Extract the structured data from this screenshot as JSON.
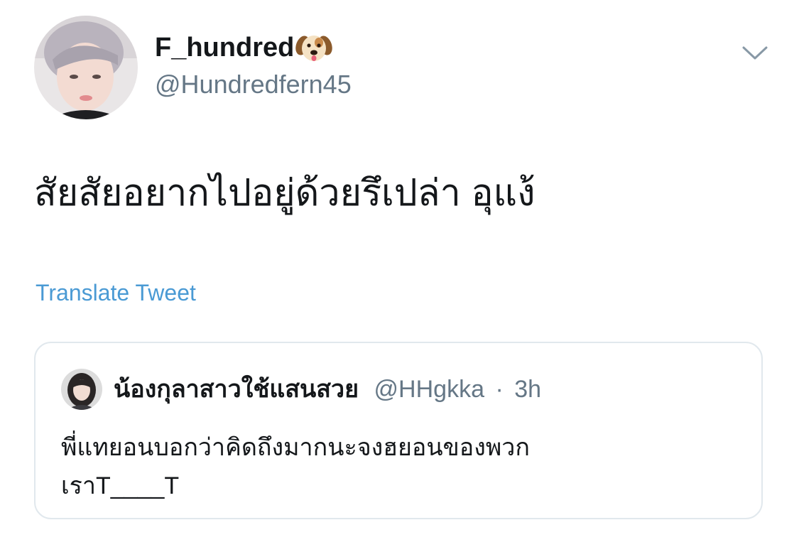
{
  "tweet": {
    "display_name": "F_hundred",
    "name_emoji": "dog-face-emoji",
    "handle": "@Hundredfern45",
    "menu_icon": "chevron-down-icon",
    "text": "สัยสัยอยากไปอยู่ด้วยรึเปล่า อุแง้",
    "translate_label": "Translate Tweet"
  },
  "quote": {
    "display_name": "น้องกุลาสาวใช้แสนสวย",
    "handle": "@HHgkka",
    "separator": "·",
    "time": "3h",
    "text_line1": "พี่แทยอนบอกว่าคิดถึงมากนะจงฮยอนของพวก",
    "text_line2": "เราT____T"
  },
  "colors": {
    "text_primary": "#14171a",
    "text_secondary": "#657786",
    "link": "#4a9ad4",
    "border": "#e1e8ed"
  }
}
